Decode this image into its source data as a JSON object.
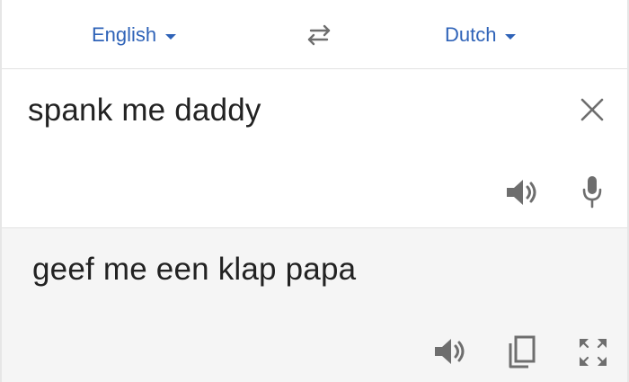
{
  "header": {
    "source_language": "English",
    "target_language": "Dutch"
  },
  "input": {
    "text": "spank me daddy"
  },
  "output": {
    "text": "geef me een klap papa"
  },
  "icons": {
    "swap": "swap-arrows-icon",
    "close": "close-icon",
    "speaker": "speaker-icon",
    "mic": "microphone-icon",
    "copy": "copy-icon",
    "fullscreen": "fullscreen-icon"
  },
  "colors": {
    "accent": "#2f63b8",
    "icon": "#6e6e6e",
    "text": "#222222",
    "output_background": "#f5f5f5"
  }
}
